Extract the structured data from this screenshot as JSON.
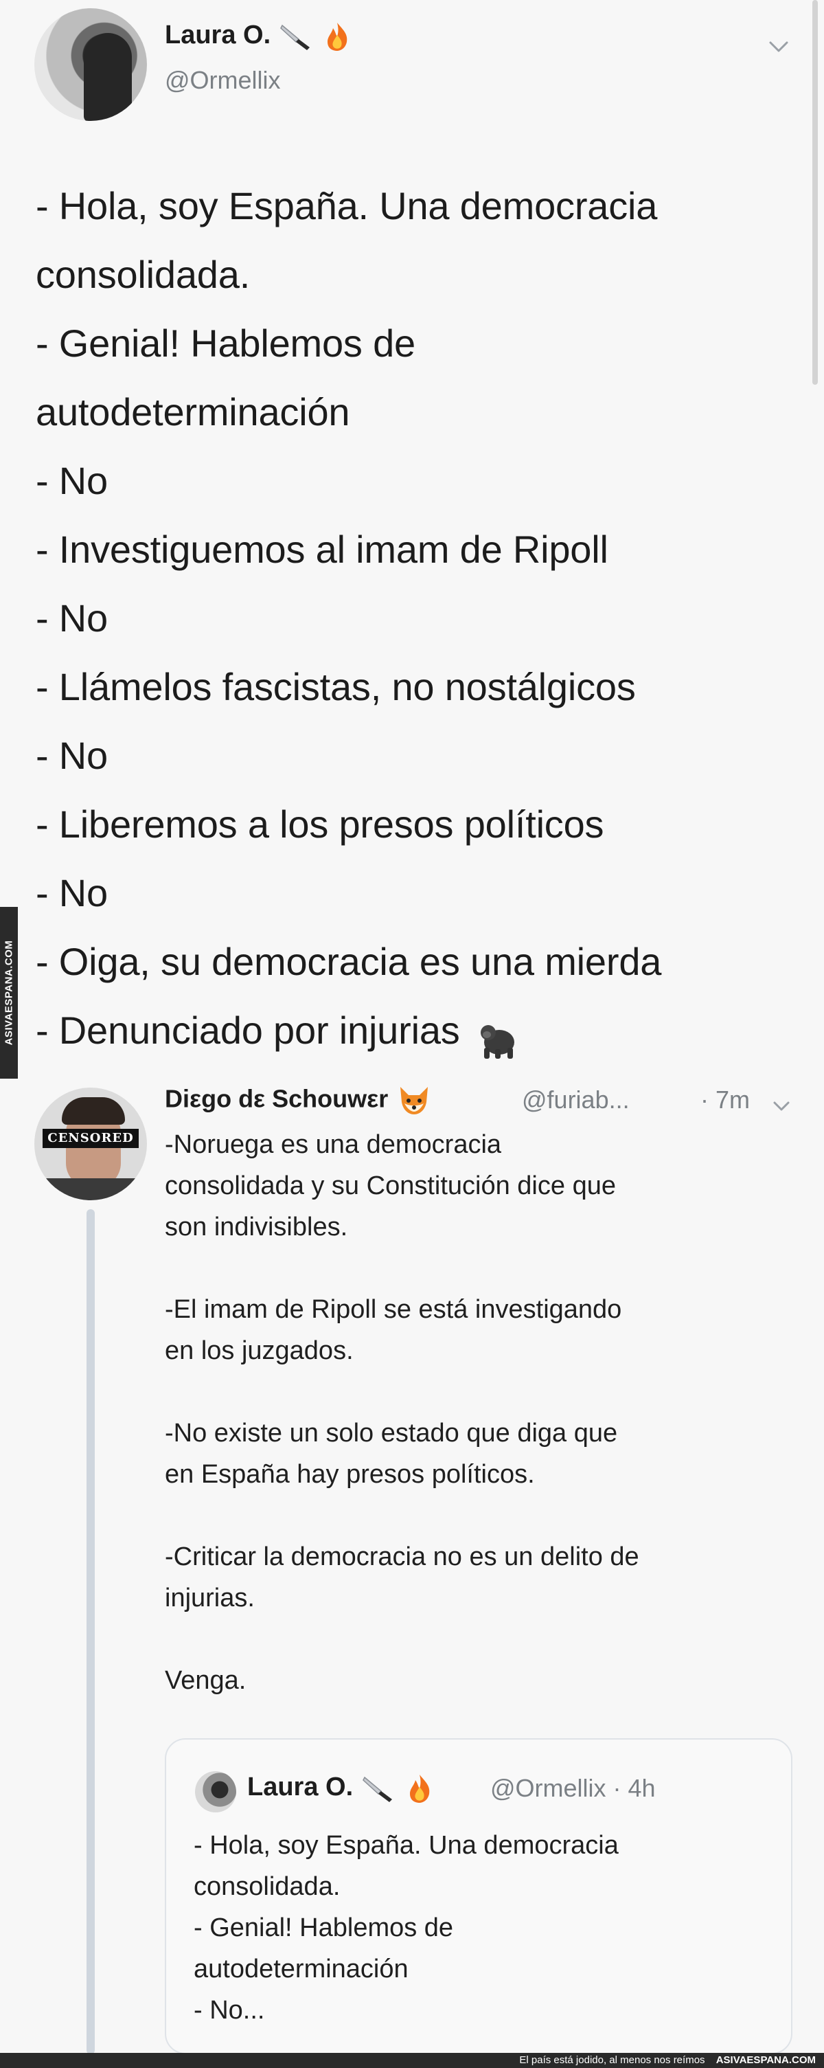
{
  "main_tweet": {
    "name": "Laura O.",
    "handle": "@Ormellix",
    "lines": [
      "- Hola, soy España. Una democracia",
      "consolidada.",
      "- Genial! Hablemos de",
      "autodeterminación",
      "- No",
      "- Investiguemos al imam de Ripoll",
      "- No",
      "- Llámelos fascistas, no nostálgicos",
      "- No",
      "- Liberemos a los presos políticos",
      "- No",
      "- Oiga, su democracia es una mierda",
      "- Denunciado por injurias"
    ],
    "name_icons": [
      "knife-icon",
      "fire-icon"
    ],
    "last_line_icon": "gorilla-icon"
  },
  "reply_tweet": {
    "name": "Diεgo dε Schouwεr",
    "name_icon": "fox-icon",
    "handle": "@furiab...",
    "time": "· 7m",
    "avatar_overlay": "CENSORED",
    "paragraphs": [
      "-Noruega es una democracia\nconsolidada y su Constitución dice que\nson indivisibles.",
      "-El imam de Ripoll se está investigando\nen los juzgados.",
      "-No existe un solo estado que diga que\nen España hay presos políticos.",
      "-Criticar la democracia no es un delito de\ninjurias.",
      "Venga."
    ]
  },
  "quoted_tweet": {
    "name": "Laura O.",
    "handle": "@Ormellix · 4h",
    "lines": [
      "- Hola, soy España. Una democracia",
      "consolidada.",
      "- Genial! Hablemos de",
      "autodeterminación",
      "- No..."
    ]
  },
  "watermark": {
    "side": "ASIVAESPANA.COM",
    "footer_text": "El país está jodido, al menos nos reímos",
    "footer_brand": "ASIVAESPANA.COM"
  },
  "colors": {
    "background": "#f7f7f7",
    "text": "#1c1c1c",
    "secondary_text": "#7b8085",
    "thread_line": "#cfd6de",
    "quote_border": "#dfe3e8"
  }
}
